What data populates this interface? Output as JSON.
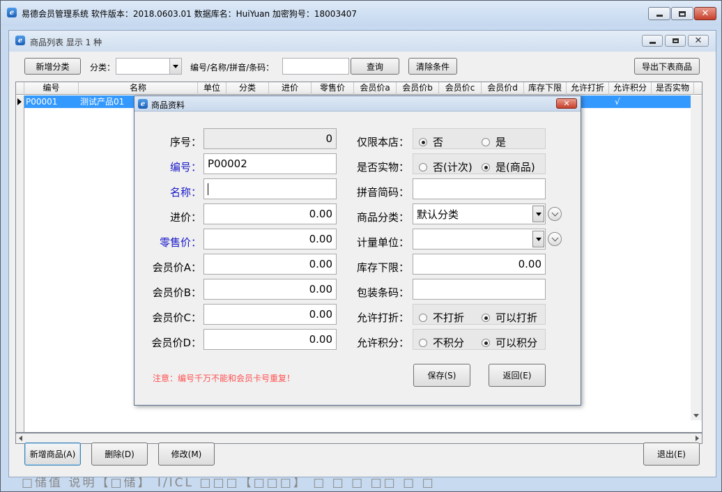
{
  "app": {
    "title": "易德会员管理系统   软件版本：2018.0603.01   数据库名：HuiYuan   加密狗号：18003407"
  },
  "window": {
    "title": "商品列表   显示 1 种",
    "toolbar": {
      "add_category": "新增分类",
      "category_label": "分类：",
      "category_value": "",
      "search_label": "编号/名称/拼音/条码：",
      "search_value": "",
      "query": "查询",
      "clear": "清除条件",
      "export": "导出下表商品"
    },
    "grid": {
      "columns": [
        "编号",
        "名称",
        "单位",
        "分类",
        "进价",
        "零售价",
        "会员价a",
        "会员价b",
        "会员价c",
        "会员价d",
        "库存下限",
        "允许打折",
        "允许积分",
        "是否实物"
      ],
      "rows": [
        {
          "code": "P00001",
          "name": "测试产品01",
          "check": "√"
        }
      ]
    },
    "bottom": {
      "add_product": "新增商品(A)",
      "delete": "删除(D)",
      "modify": "修改(M)",
      "exit": "退出(E)"
    }
  },
  "dialog": {
    "title": "商品资料",
    "fields": {
      "seq_label": "序号：",
      "seq_value": "0",
      "code_label": "编号：",
      "code_value": "P00002",
      "name_label": "名称：",
      "name_value": "",
      "cost_label": "进价：",
      "cost_value": "0.00",
      "retail_label": "零售价：",
      "retail_value": "0.00",
      "pa_label": "会员价A：",
      "pa_value": "0.00",
      "pb_label": "会员价B：",
      "pb_value": "0.00",
      "pc_label": "会员价C：",
      "pc_value": "0.00",
      "pd_label": "会员价D：",
      "pd_value": "0.00",
      "store_only_label": "仅限本店：",
      "store_only_no": "否",
      "store_only_yes": "是",
      "physical_label": "是否实物：",
      "physical_no": "否(计次)",
      "physical_yes": "是(商品)",
      "pinyin_label": "拼音简码：",
      "pinyin_value": "",
      "category_label": "商品分类：",
      "category_value": "默认分类",
      "unit_label": "计量单位：",
      "unit_value": "",
      "min_stock_label": "库存下限：",
      "min_stock_value": "0.00",
      "barcode_label": "包装条码：",
      "barcode_value": "",
      "discount_label": "允许打折：",
      "discount_no": "不打折",
      "discount_yes": "可以打折",
      "points_label": "允许积分：",
      "points_no": "不积分",
      "points_yes": "可以积分"
    },
    "note": "注意：编号千万不能和会员卡号重复！",
    "save": "保存(S)",
    "back": "返回(E)"
  },
  "ghost_text": "□储值  说明【□储】       I/ICL      □□□【□□□】        □  □  □  □□ □  □"
}
